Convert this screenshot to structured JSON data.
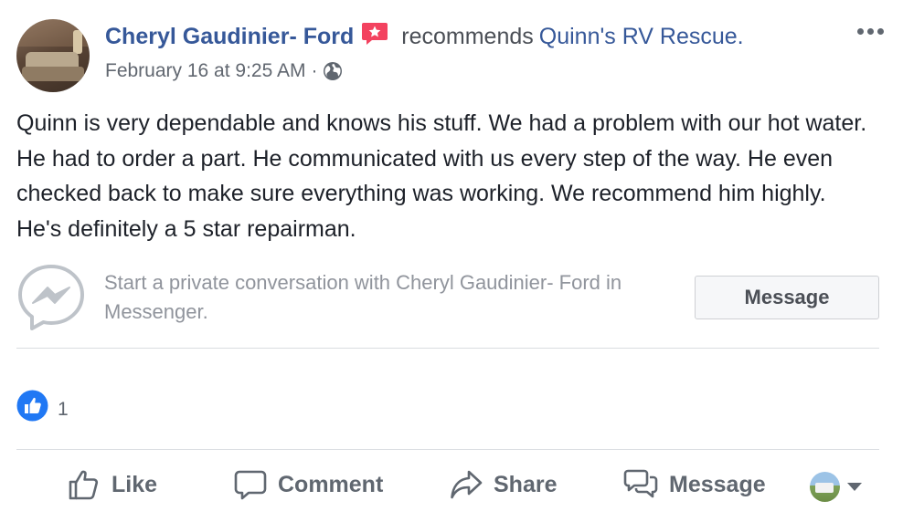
{
  "post": {
    "author": "Cheryl Gaudinier- Ford",
    "action_text": "recommends",
    "page_name": "Quinn's RV Rescue.",
    "timestamp": "February 16 at 9:25 AM",
    "separator": "·",
    "privacy_icon": "globe-icon",
    "badge_icon": "recommendation-star-icon",
    "body": "Quinn is very dependable and knows his stuff. We had a problem with our hot water. He had to order a part. He communicated with us every step of the way. He even checked back to make sure everything was working. We recommend him highly. He's definitely a 5 star repairman."
  },
  "messenger_prompt": {
    "text": "Start a private conversation with Cheryl Gaudinier- Ford in Messenger.",
    "button_label": "Message",
    "icon": "messenger-icon"
  },
  "reactions": {
    "icon": "like-reaction-icon",
    "count": "1"
  },
  "actions": {
    "like": "Like",
    "comment": "Comment",
    "share": "Share",
    "message": "Message"
  },
  "colors": {
    "link_blue": "#365899",
    "meta_gray": "#616770",
    "like_blue": "#2078f4",
    "badge_red": "#f3425f"
  }
}
